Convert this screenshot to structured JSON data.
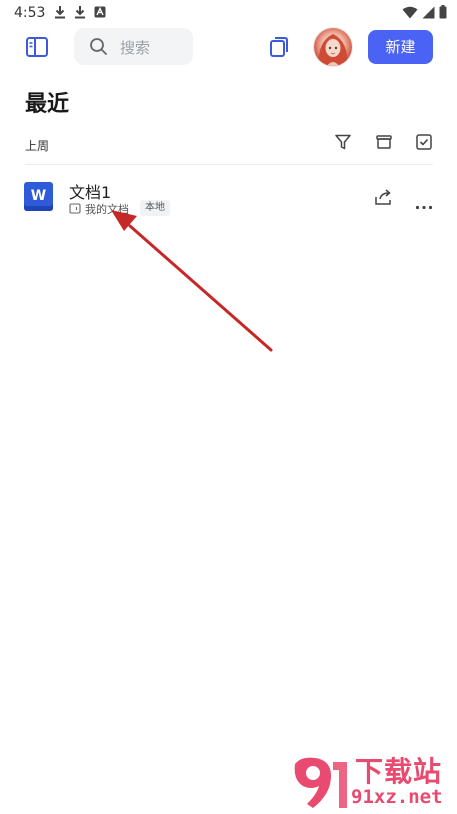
{
  "status_bar": {
    "time": "4:53",
    "icons": [
      "download-icon",
      "download-icon",
      "app-notification-icon",
      "wifi-icon",
      "signal-icon",
      "battery-icon"
    ]
  },
  "toolbar": {
    "search_placeholder": "搜索",
    "new_button_label": "新建",
    "accent_color": "#4a63f5"
  },
  "page": {
    "title": "最近"
  },
  "section": {
    "label": "上周",
    "actions": [
      "filter-icon",
      "archive-icon",
      "select-icon"
    ]
  },
  "files": [
    {
      "name": "文档1",
      "type_icon": "W",
      "location": "我的文档",
      "badge": "本地"
    }
  ],
  "watermark": {
    "logo_text": "9",
    "title": "下载站",
    "url": "91xz.net",
    "color": "#e94a6f"
  }
}
